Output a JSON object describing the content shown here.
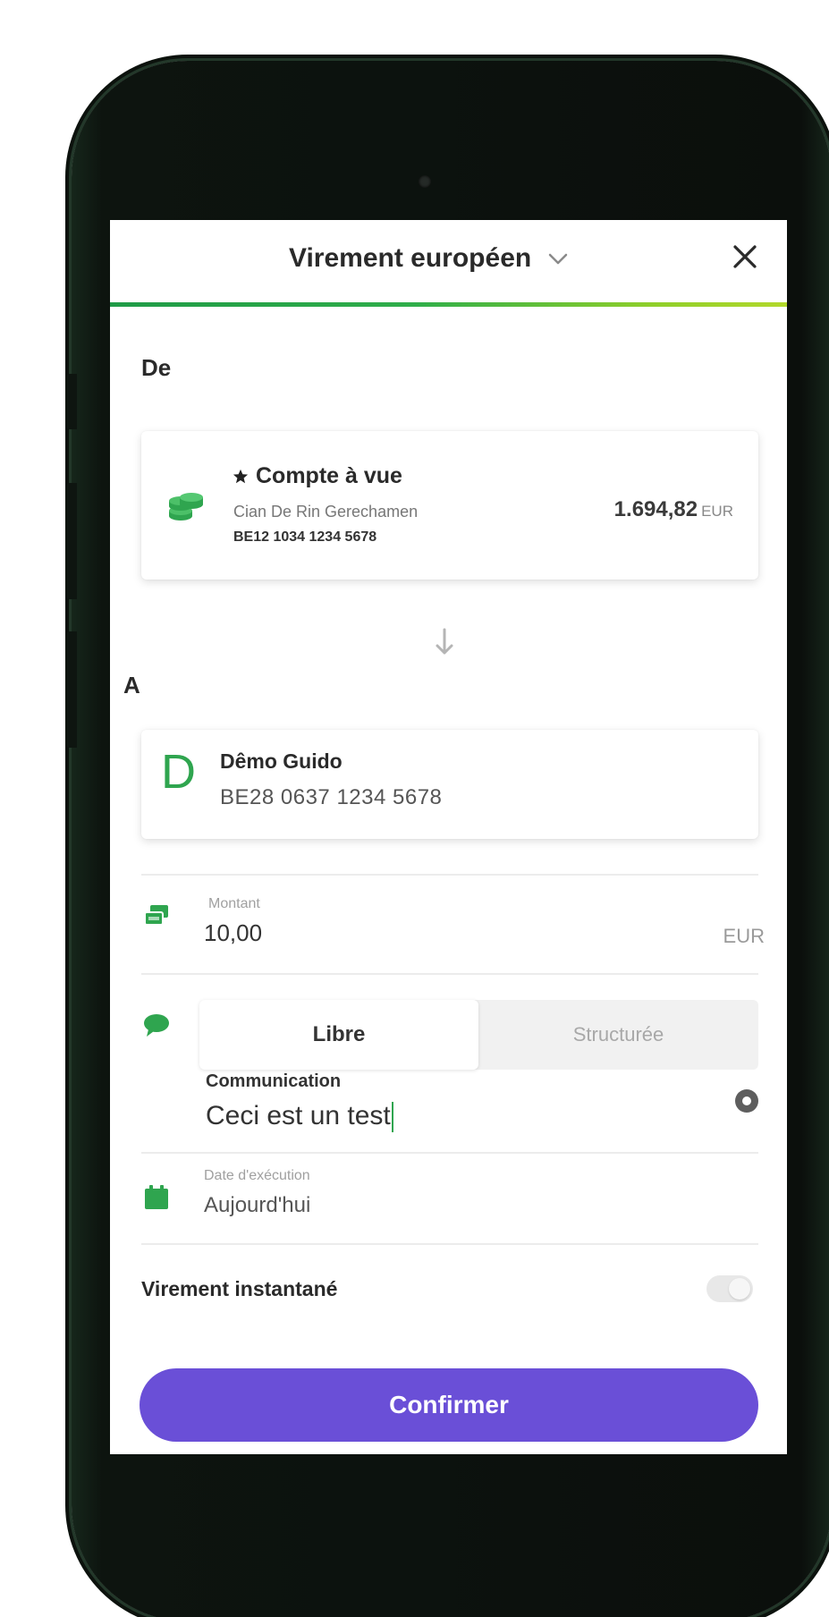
{
  "header": {
    "title": "Virement européen",
    "progress_color_start": "#1f9b47",
    "progress_color_end": "#b2d82b"
  },
  "from": {
    "label": "De",
    "account_name": "Compte à vue",
    "owner": "Cian De Rin Gerechamen",
    "iban": "BE12 1034 1234 5678",
    "balance": "1.694,82",
    "currency": "EUR"
  },
  "to": {
    "label": "A",
    "avatar_letter": "D",
    "name": "Dêmo Guido",
    "iban": "BE28 0637 1234 5678"
  },
  "amount": {
    "label": "Montant",
    "value": "10,00",
    "currency": "EUR"
  },
  "communication": {
    "tabs": [
      "Libre",
      "Structurée"
    ],
    "active_tab": "Libre",
    "label": "Communication",
    "value": "Ceci est un test"
  },
  "execution_date": {
    "label": "Date d'exécution",
    "value": "Aujourd'hui"
  },
  "instant_transfer": {
    "label": "Virement instantané",
    "enabled": false
  },
  "confirm_button": {
    "label": "Confirmer",
    "color": "#6a4fd7"
  },
  "colors": {
    "brand_green": "#2fa54f",
    "accent_purple": "#6a4fd7"
  }
}
